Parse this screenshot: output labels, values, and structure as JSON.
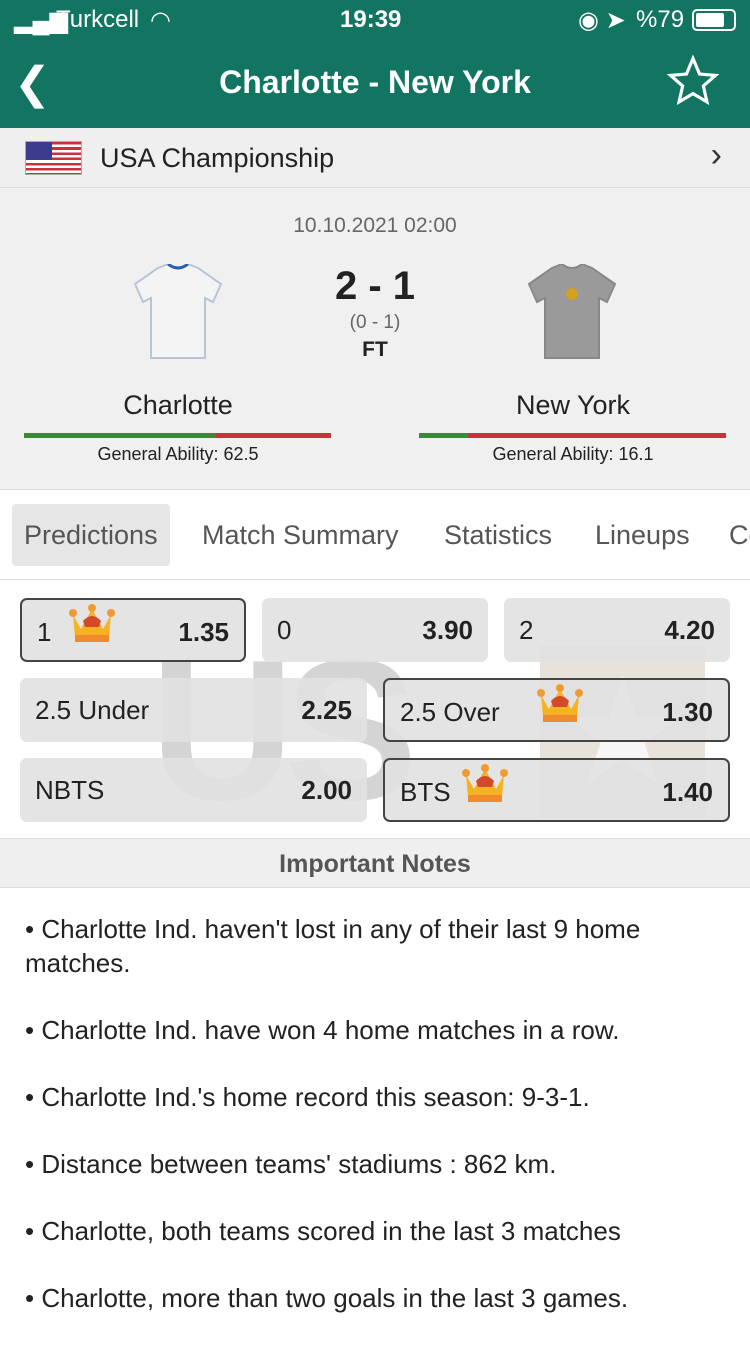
{
  "status": {
    "carrier": "Turkcell",
    "time": "19:39",
    "battery": "%79"
  },
  "nav": {
    "title": "Charlotte  - New York"
  },
  "league": {
    "name": "USA Championship"
  },
  "match": {
    "date": "10.10.2021 02:00",
    "score": "2 - 1",
    "half_time": "(0 - 1)",
    "status": "FT",
    "home": {
      "name": "Charlotte",
      "ability_label": "General Ability: 62.5",
      "ability": 62.5
    },
    "away": {
      "name": "New York",
      "ability_label": "General Ability: 16.1",
      "ability": 16.1
    }
  },
  "tabs": [
    "Predictions",
    "Match Summary",
    "Statistics",
    "Lineups",
    "Co"
  ],
  "predictions": [
    {
      "label": "1",
      "odd": "1.35",
      "crown": true,
      "selected": true
    },
    {
      "label": "0",
      "odd": "3.90",
      "crown": false,
      "selected": false
    },
    {
      "label": "2",
      "odd": "4.20",
      "crown": false,
      "selected": false
    },
    {
      "label": "2.5 Under",
      "odd": "2.25",
      "crown": false,
      "selected": false
    },
    {
      "label": "2.5 Over",
      "odd": "1.30",
      "crown": true,
      "selected": true
    },
    {
      "label": "NBTS",
      "odd": "2.00",
      "crown": false,
      "selected": false
    },
    {
      "label": "BTS",
      "odd": "1.40",
      "crown": true,
      "selected": true
    }
  ],
  "watermark": "USL",
  "notes": {
    "title": "Important Notes",
    "items": [
      "• Charlotte Ind. haven't lost in any of their last 9 home matches.",
      "• Charlotte Ind. have won 4 home matches in a row.",
      "• Charlotte Ind.'s home record this season: 9-3-1.",
      "• Distance between teams' stadiums : 862 km.",
      "• Charlotte, both teams scored in the last 3 matches",
      "• Charlotte, more than two goals in the last 3 games."
    ]
  },
  "colors": {
    "header": "#117562",
    "ability_good": "#3a8a3a",
    "ability_bad": "#c8323c"
  }
}
